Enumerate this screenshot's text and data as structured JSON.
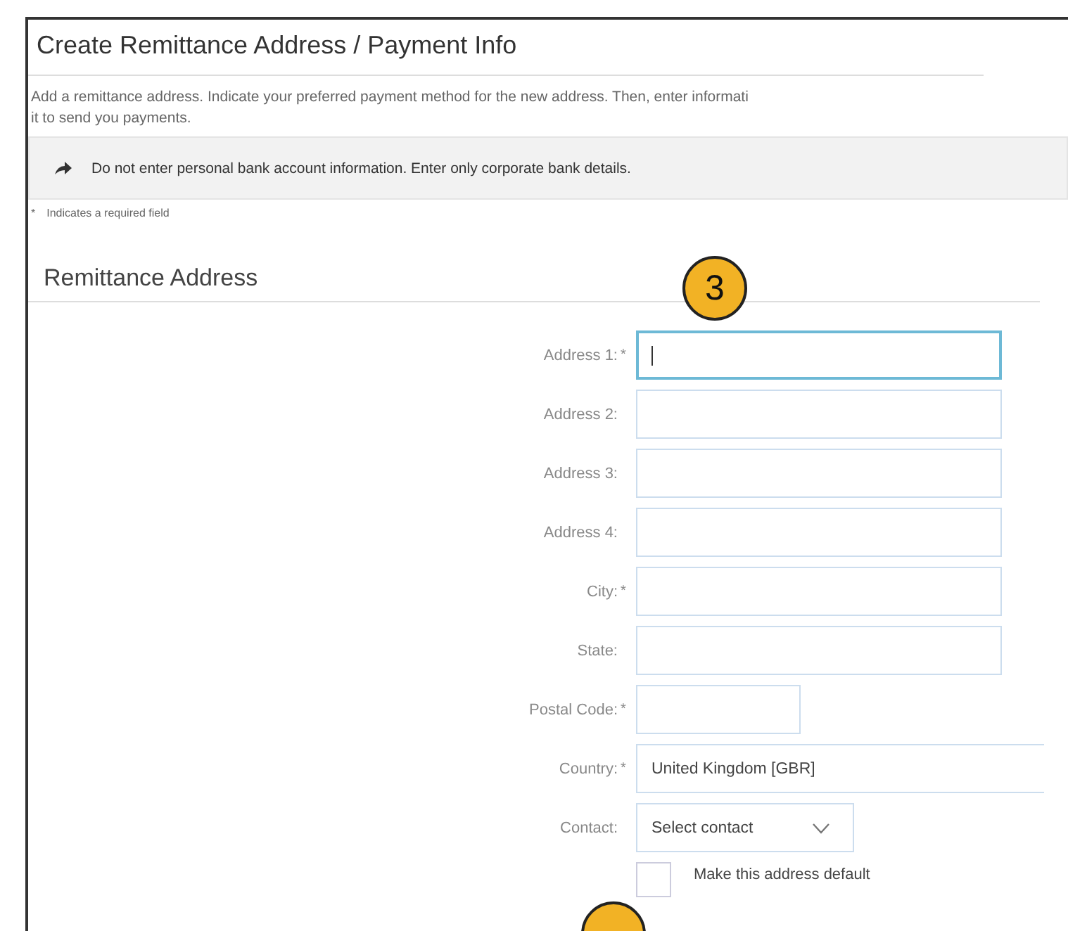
{
  "title": "Create Remittance Address / Payment Info",
  "description": "Add a remittance address. Indicate your preferred payment method for the new address. Then, enter informati\nit to send you payments.",
  "notice": "Do not enter personal bank account information. Enter only corporate bank details.",
  "required_note": "Indicates a required field",
  "required_mark": "*",
  "step_badges": [
    {
      "label": "3"
    },
    {
      "kind": "cut"
    }
  ],
  "section": {
    "title": "Remittance Address",
    "fields": [
      {
        "label": "Address 1:",
        "required": true,
        "kind": "text",
        "focused": true
      },
      {
        "label": "Address 2:",
        "required": false,
        "kind": "text",
        "focused": false
      },
      {
        "label": "Address 3:",
        "required": false,
        "kind": "text",
        "focused": false
      },
      {
        "label": "Address 4:",
        "required": false,
        "kind": "text",
        "focused": false
      },
      {
        "label": "City:",
        "required": true,
        "kind": "text",
        "focused": false
      },
      {
        "label": "State:",
        "required": false,
        "kind": "text",
        "focused": false
      },
      {
        "label": "Postal Code:",
        "required": true,
        "kind": "short-text",
        "focused": false
      },
      {
        "label": "Country:",
        "required": true,
        "kind": "wide-text",
        "value": "United Kingdom  [GBR]",
        "focused": false
      },
      {
        "label": "Contact:",
        "required": false,
        "kind": "select",
        "value": "Select contact"
      },
      {
        "kind": "checkbox",
        "label": "Make this address default",
        "checked": false
      }
    ]
  }
}
